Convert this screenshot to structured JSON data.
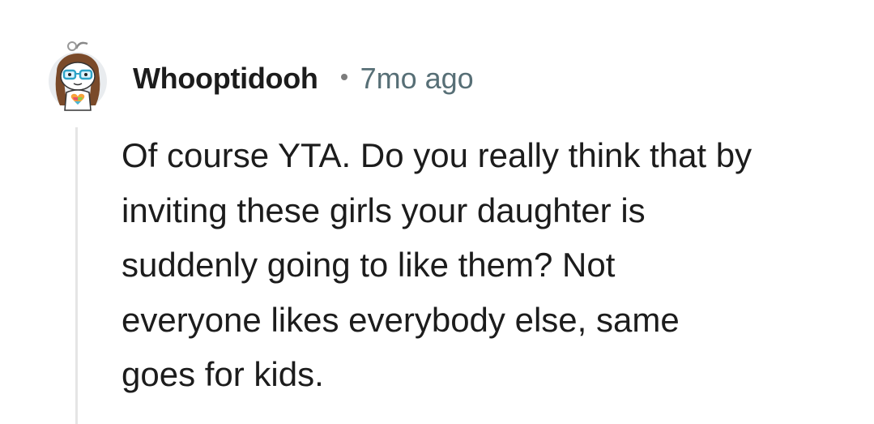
{
  "comment": {
    "avatar_icon": "snoo-avatar-icon",
    "username": "Whooptidooh",
    "timestamp": "7mo ago",
    "body": "Of course YTA. Do you really think that by\ninviting these girls your daughter is\nsuddenly going to like them? Not\neveryone likes everybody else, same\ngoes for kids."
  },
  "colors": {
    "text": "#1c1c1c",
    "meta": "#576f76",
    "thread_line": "#e5e5e5"
  }
}
